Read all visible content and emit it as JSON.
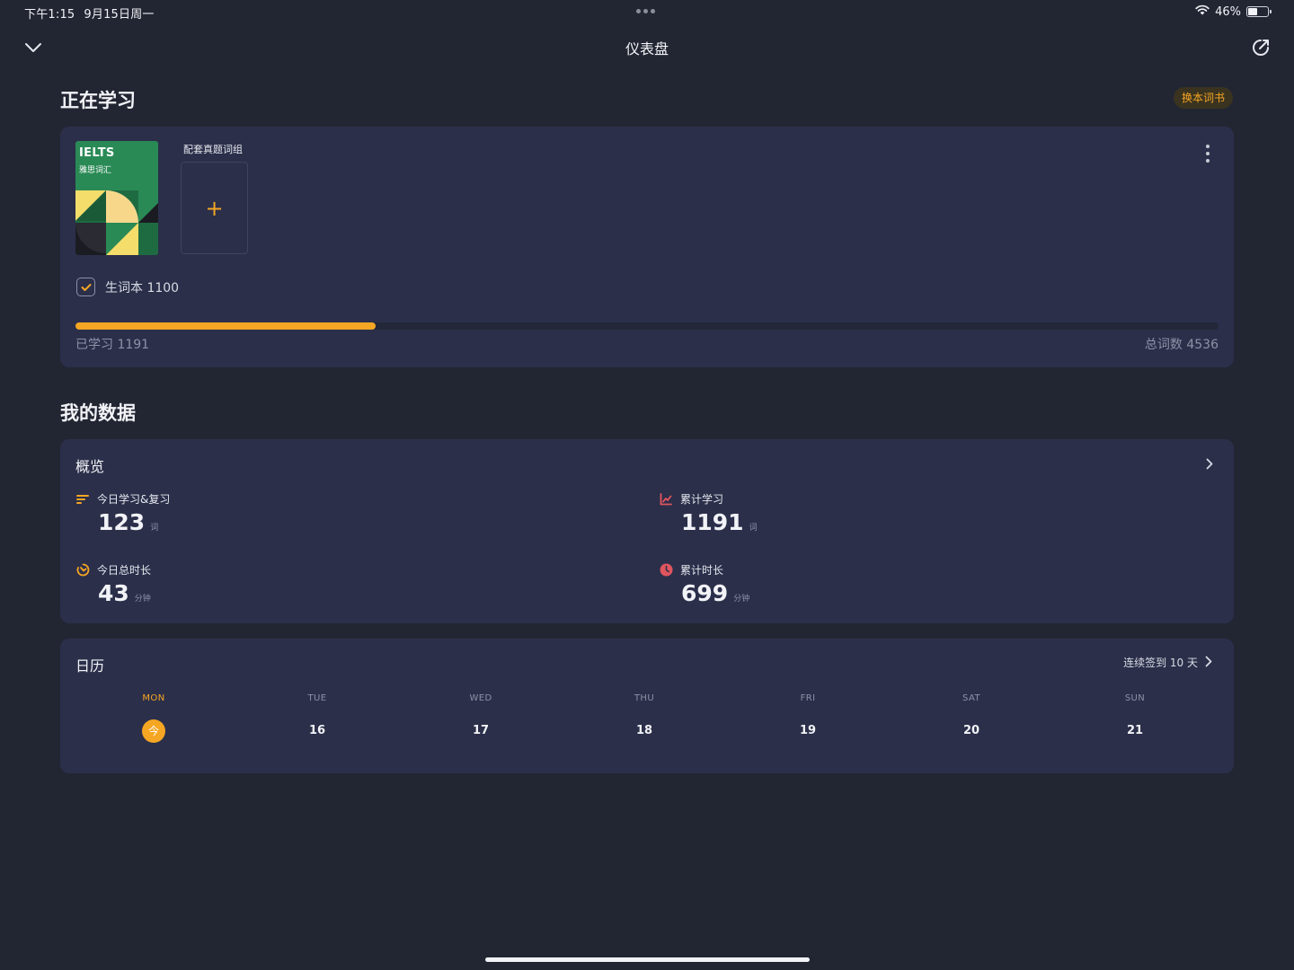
{
  "status_bar": {
    "time": "下午1:15",
    "date": "9月15日周一",
    "battery": "46%",
    "battery_level": 0.46
  },
  "nav": {
    "title": "仪表盘",
    "back_icon": "chevron-down-icon",
    "share_icon": "share-icon"
  },
  "studying": {
    "section_title": "正在学习",
    "change_book_label": "换本词书",
    "book": {
      "title_en": "IELTS",
      "title_cn": "雅思词汇"
    },
    "group_label": "配套真题词组",
    "add_symbol": "+",
    "wordbook_label": "生词本 1100",
    "learned_label": "已学习 1191",
    "total_label": "总词数 4536",
    "learned": 1191,
    "total": 4536
  },
  "my_data": {
    "section_title": "我的数据",
    "overview": {
      "title": "概览",
      "stats": [
        {
          "label": "今日学习&复习",
          "value": "123",
          "unit": "词",
          "icon": "list-icon",
          "color": "#f5a623"
        },
        {
          "label": "累计学习",
          "value": "1191",
          "unit": "词",
          "icon": "line-chart-icon",
          "color": "#e0555e"
        },
        {
          "label": "今日总时长",
          "value": "43",
          "unit": "分钟",
          "icon": "timer-icon",
          "color": "#f5a623"
        },
        {
          "label": "累计时长",
          "value": "699",
          "unit": "分钟",
          "icon": "clock-icon",
          "color": "#e0555e"
        }
      ]
    },
    "calendar": {
      "title": "日历",
      "streak": "连续签到 10 天",
      "days": [
        {
          "dow": "MON",
          "num": "今",
          "today": true
        },
        {
          "dow": "TUE",
          "num": "16"
        },
        {
          "dow": "WED",
          "num": "17"
        },
        {
          "dow": "THU",
          "num": "18"
        },
        {
          "dow": "FRI",
          "num": "19"
        },
        {
          "dow": "SAT",
          "num": "20"
        },
        {
          "dow": "SUN",
          "num": "21"
        }
      ]
    }
  },
  "colors": {
    "accent": "#f5a623",
    "background": "#222633",
    "card": "#2b2f4a",
    "red": "#e0555e"
  }
}
